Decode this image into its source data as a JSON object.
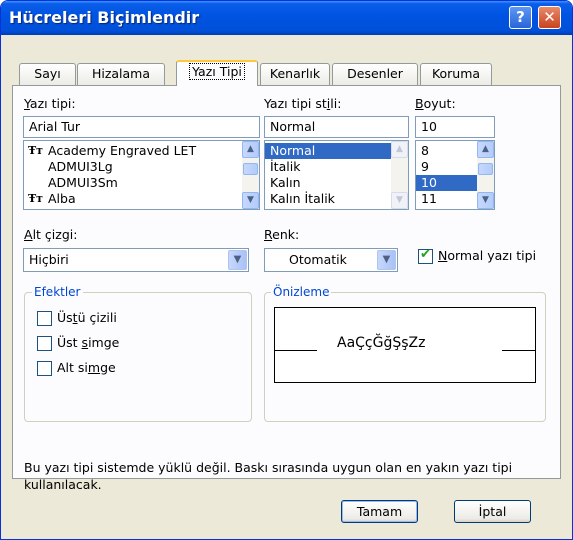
{
  "window": {
    "title": "Hücreleri Biçimlendir",
    "help_glyph": "?",
    "close_glyph": "✕"
  },
  "tabs": [
    {
      "label": "Sayı"
    },
    {
      "label": "Hizalama"
    },
    {
      "label": "Yazı Tipi",
      "active": true
    },
    {
      "label": "Kenarlık"
    },
    {
      "label": "Desenler"
    },
    {
      "label": "Koruma"
    }
  ],
  "font": {
    "label_u": "Y",
    "label_rest": "azı tipi:",
    "value": "Arial Tur",
    "items": [
      "Academy Engraved LET",
      "ADMUI3Lg",
      "ADMUI3Sm",
      "Alba"
    ],
    "truetype_glyph": "Ŧᴛ"
  },
  "style": {
    "label_pre": "Yazı tipi st",
    "label_u": "i",
    "label_post": "li:",
    "value": "Normal",
    "items": [
      "Normal",
      "İtalik",
      "Kalın",
      "Kalın İtalik"
    ],
    "selected_index": 0
  },
  "size": {
    "label_u": "B",
    "label_rest": "oyut:",
    "value": "10",
    "items": [
      "8",
      "9",
      "10",
      "11"
    ],
    "selected_index": 2
  },
  "underline": {
    "label_u": "A",
    "label_rest": "lt çizgi:",
    "value": "Hiçbiri"
  },
  "color": {
    "label_u": "R",
    "label_rest": "enk:",
    "value": "Otomatik"
  },
  "normal_font": {
    "label_u": "N",
    "label_rest": "ormal yazı tipi",
    "checked": true
  },
  "effects": {
    "legend": "Efektler",
    "items": [
      {
        "pre": "Üs",
        "u": "t",
        "post": "ü çizili",
        "checked": false
      },
      {
        "pre": "Üst ",
        "u": "s",
        "post": "imge",
        "checked": false
      },
      {
        "pre": "Alt si",
        "u": "m",
        "post": "ge",
        "checked": false
      }
    ]
  },
  "preview": {
    "legend": "Önizleme",
    "sample": "AaÇçĞğŞşZz"
  },
  "info_text_1": "Bu yazı tipi sistemde yüklü değil. Baskı sırasında uygun olan en yakın yazı tipi",
  "info_text_2": "kullanılacak.",
  "buttons": {
    "ok": "Tamam",
    "cancel": "İptal"
  },
  "colors": {
    "titlebar": "#0054e3",
    "selection": "#316ac5",
    "dialog_bg": "#ece9d8",
    "legend": "#0046d5"
  }
}
